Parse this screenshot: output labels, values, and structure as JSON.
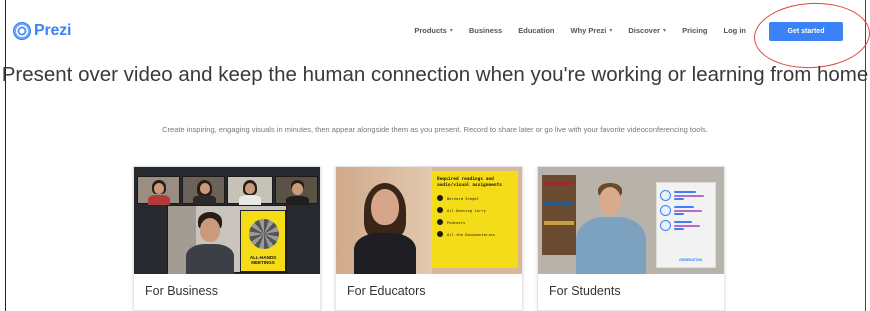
{
  "brand": {
    "name": "Prezi"
  },
  "nav": {
    "items": [
      {
        "label": "Products",
        "has_caret": true
      },
      {
        "label": "Business",
        "has_caret": false
      },
      {
        "label": "Education",
        "has_caret": false
      },
      {
        "label": "Why Prezi",
        "has_caret": true
      },
      {
        "label": "Discover",
        "has_caret": true
      },
      {
        "label": "Pricing",
        "has_caret": false
      },
      {
        "label": "Log in",
        "has_caret": false
      }
    ],
    "cta_label": "Get started"
  },
  "hero": {
    "title": "Present over video and keep the human connection when you're working or learning from home",
    "subtitle": "Create inspiring, engaging visuals in minutes, then appear alongside them as you present. Record to share later or go live with your favorite videoconferencing tools."
  },
  "cards": [
    {
      "label": "For Business",
      "slide_text": "ALL-HANDS MEETINGS"
    },
    {
      "label": "For Educators",
      "slide_title": "Required readings and audio/visual assignments",
      "slide_items": [
        "Bernard Stegel",
        "All Dancing Jerry",
        "Podcasts",
        "All the Documentaries"
      ]
    },
    {
      "label": "For Students",
      "panel_footer": "GENERATION"
    }
  ],
  "colors": {
    "accent": "#3b82f6",
    "annotation": "#e0443b",
    "slide_yellow": "#f5dc18"
  }
}
